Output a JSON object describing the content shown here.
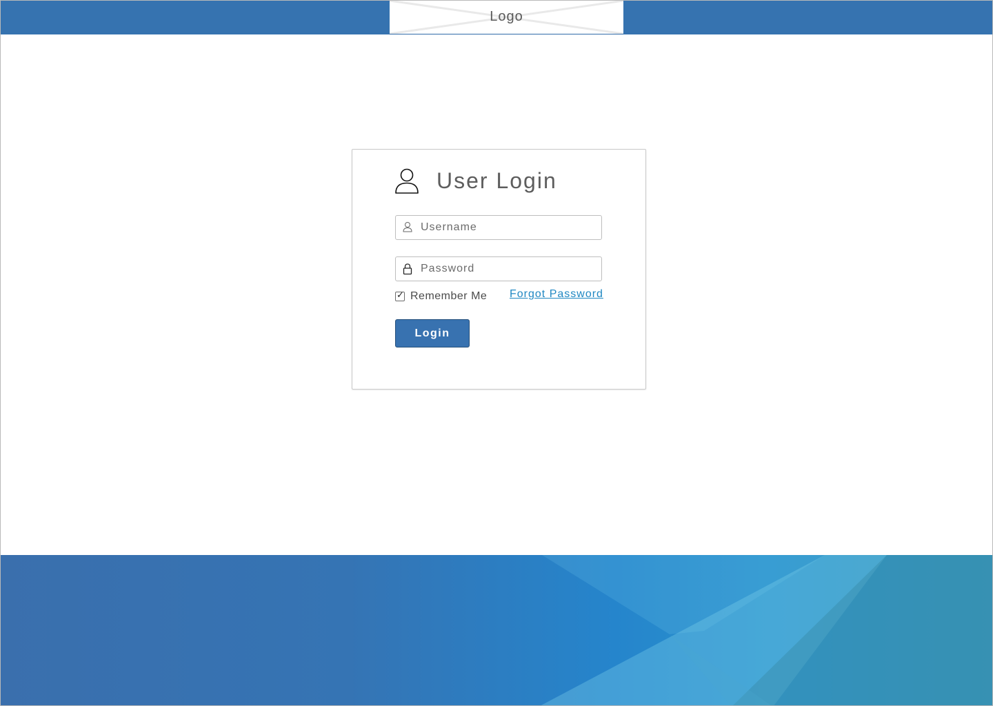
{
  "header": {
    "logo_text": "Logo"
  },
  "login": {
    "title": "User Login",
    "title_icon": "user-icon",
    "username": {
      "placeholder": "Username",
      "value": "",
      "icon": "user-icon"
    },
    "password": {
      "placeholder": "Password",
      "value": "",
      "icon": "lock-icon"
    },
    "remember_me": {
      "label": "Remember Me",
      "checked": true,
      "check_glyph": "✓"
    },
    "forgot_password_label": "Forgot Password",
    "login_button_label": "Login"
  },
  "colors": {
    "header_bar": "#3673b0",
    "button": "#3872b0",
    "link": "#1f87c2",
    "footer_start": "#3a6fad",
    "footer_mid": "#2585cc",
    "footer_end": "#3392b5"
  }
}
